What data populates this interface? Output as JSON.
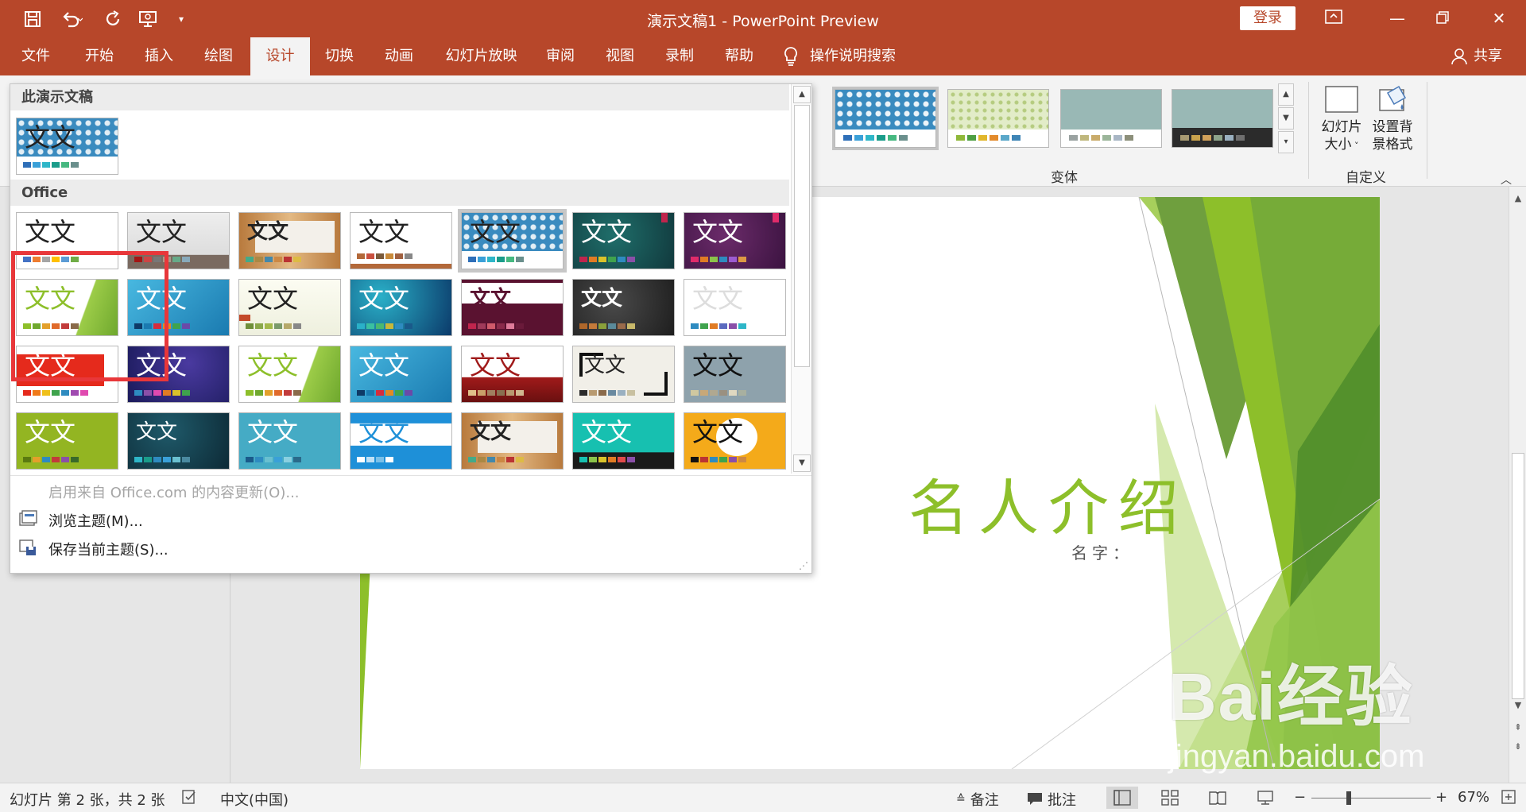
{
  "titlebar": {
    "title": "演示文稿1  -  PowerPoint Preview",
    "login": "登录",
    "undo_icon": "undo-icon",
    "redo_icon": "redo-icon",
    "save_icon": "save-icon"
  },
  "tabs": [
    "文件",
    "开始",
    "插入",
    "绘图",
    "设计",
    "切换",
    "动画",
    "幻灯片放映",
    "审阅",
    "视图",
    "录制",
    "帮助"
  ],
  "active_tab": "设计",
  "tell_me": "操作说明搜索",
  "share": "共享",
  "ribbon": {
    "variants_label": "变体",
    "customize_label": "自定义",
    "slide_size": "幻灯片大小",
    "slide_size_l1": "幻灯片",
    "slide_size_l2": "大小",
    "format_bg_l1": "设置背",
    "format_bg_l2": "景格式"
  },
  "dropdown": {
    "this_presentation": "此演示文稿",
    "office": "Office",
    "theme_glyph": "文文",
    "cmd_updates": "启用来自 Office.com 的内容更新(O)...",
    "cmd_browse": "浏览主题(M)...",
    "cmd_save": "保存当前主题(S)..."
  },
  "slide": {
    "title": "名人介绍",
    "subtitle": "名字："
  },
  "statusbar": {
    "slide_info": "幻灯片 第 2 张，共 2 张",
    "language": "中文(中国)",
    "notes": "备注",
    "comments": "批注",
    "zoom": "67%"
  },
  "watermark": {
    "brand": "Bai经验",
    "url": "jingyan.baidu.com"
  },
  "colors": {
    "accent": "#b7472a",
    "slide_green": "#8dbf2a",
    "highlight_red": "#e8373a"
  }
}
